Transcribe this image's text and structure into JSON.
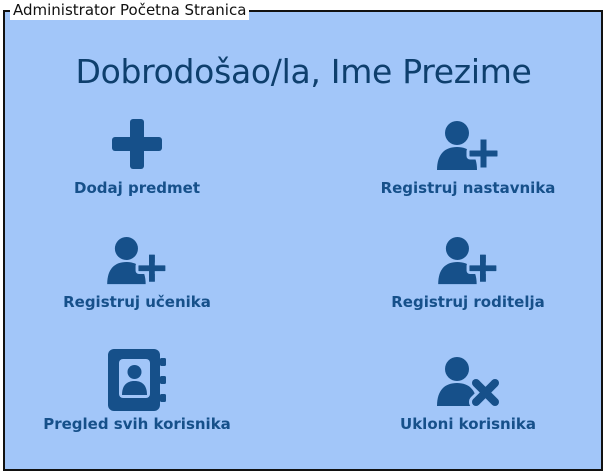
{
  "window": {
    "title": "Administrator Početna Stranica"
  },
  "header": {
    "welcome": "Dobrodošao/la, Ime Prezime"
  },
  "actions": [
    {
      "label": "Dodaj predmet",
      "icon": "plus-icon"
    },
    {
      "label": "Registruj nastavnika",
      "icon": "user-plus-icon"
    },
    {
      "label": "Registruj učenika",
      "icon": "user-plus-icon"
    },
    {
      "label": "Registruj roditelja",
      "icon": "user-plus-icon"
    },
    {
      "label": "Pregled svih korisnika",
      "icon": "address-book-icon"
    },
    {
      "label": "Ukloni korisnika",
      "icon": "user-remove-icon"
    }
  ],
  "colors": {
    "background": "#a2c6f9",
    "icon": "#16508a",
    "heading": "#0e3f6d"
  }
}
